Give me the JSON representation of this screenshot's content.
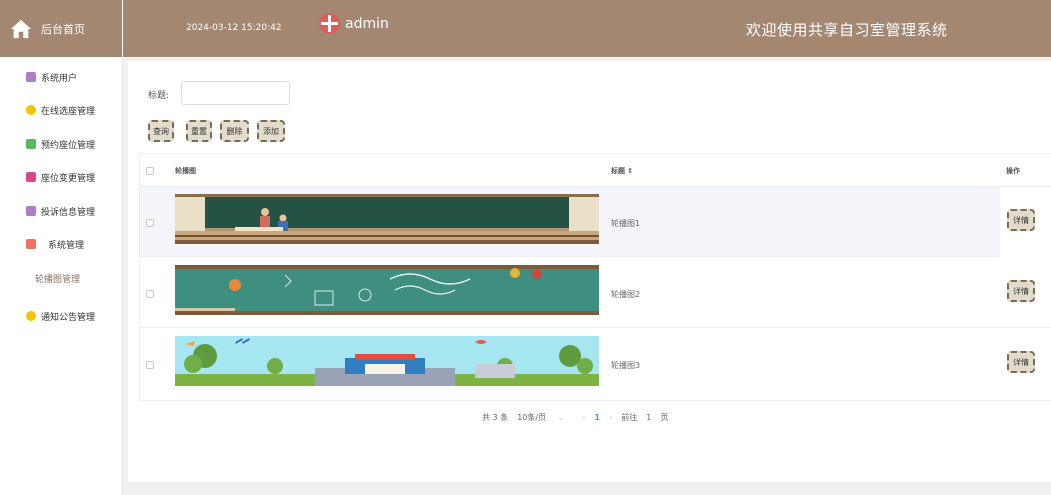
{
  "header": {
    "home_label": "后台首页",
    "datetime": "2024-03-12 15:20:42",
    "username": "admin",
    "system_title": "欢迎使用共享自习室管理系统"
  },
  "sidebar": {
    "items": [
      {
        "label": "系统用户",
        "icon": "user-icon",
        "color": "#b07cc6"
      },
      {
        "label": "在线选座管理",
        "icon": "seat-icon",
        "color": "#f2c500"
      },
      {
        "label": "预约座位管理",
        "icon": "chat-icon",
        "color": "#5cb85c"
      },
      {
        "label": "座位变更管理",
        "icon": "document-icon",
        "color": "#d9488c"
      },
      {
        "label": "投诉信息管理",
        "icon": "inbox-icon",
        "color": "#b07cc6"
      },
      {
        "label": "系统管理",
        "icon": "grid-icon",
        "color": "#f0715f"
      },
      {
        "label": "轮播图管理",
        "icon": "",
        "color": ""
      },
      {
        "label": "通知公告管理",
        "icon": "bell-icon",
        "color": "#f2c500"
      }
    ]
  },
  "search": {
    "label": "标题:",
    "value": "",
    "placeholder": ""
  },
  "toolbar": {
    "search_label": "查询",
    "reset_label": "重置",
    "delete_label": "删除",
    "add_label": "添加"
  },
  "table": {
    "columns": [
      "轮播图",
      "标题 ⇕",
      "操作"
    ],
    "rows": [
      {
        "title": "轮播图1",
        "image": "classroom-chalkboard-image",
        "action": "详情"
      },
      {
        "title": "轮播图2",
        "image": "green-chalkboard-doodle-image",
        "action": "详情"
      },
      {
        "title": "轮播图3",
        "image": "school-building-cartoon-image",
        "action": "详情"
      }
    ]
  },
  "pagination": {
    "total": "共 3 条",
    "page_size": "10条/页",
    "dropdown": "⌄",
    "prev": "‹",
    "current": "1",
    "next": "›",
    "goto_label": "前往",
    "goto_value": "1",
    "page_unit": "页"
  },
  "colors": {
    "header_bg": "#a48771",
    "button_bg": "#e3dccb",
    "accent_blue": "#409eff"
  }
}
